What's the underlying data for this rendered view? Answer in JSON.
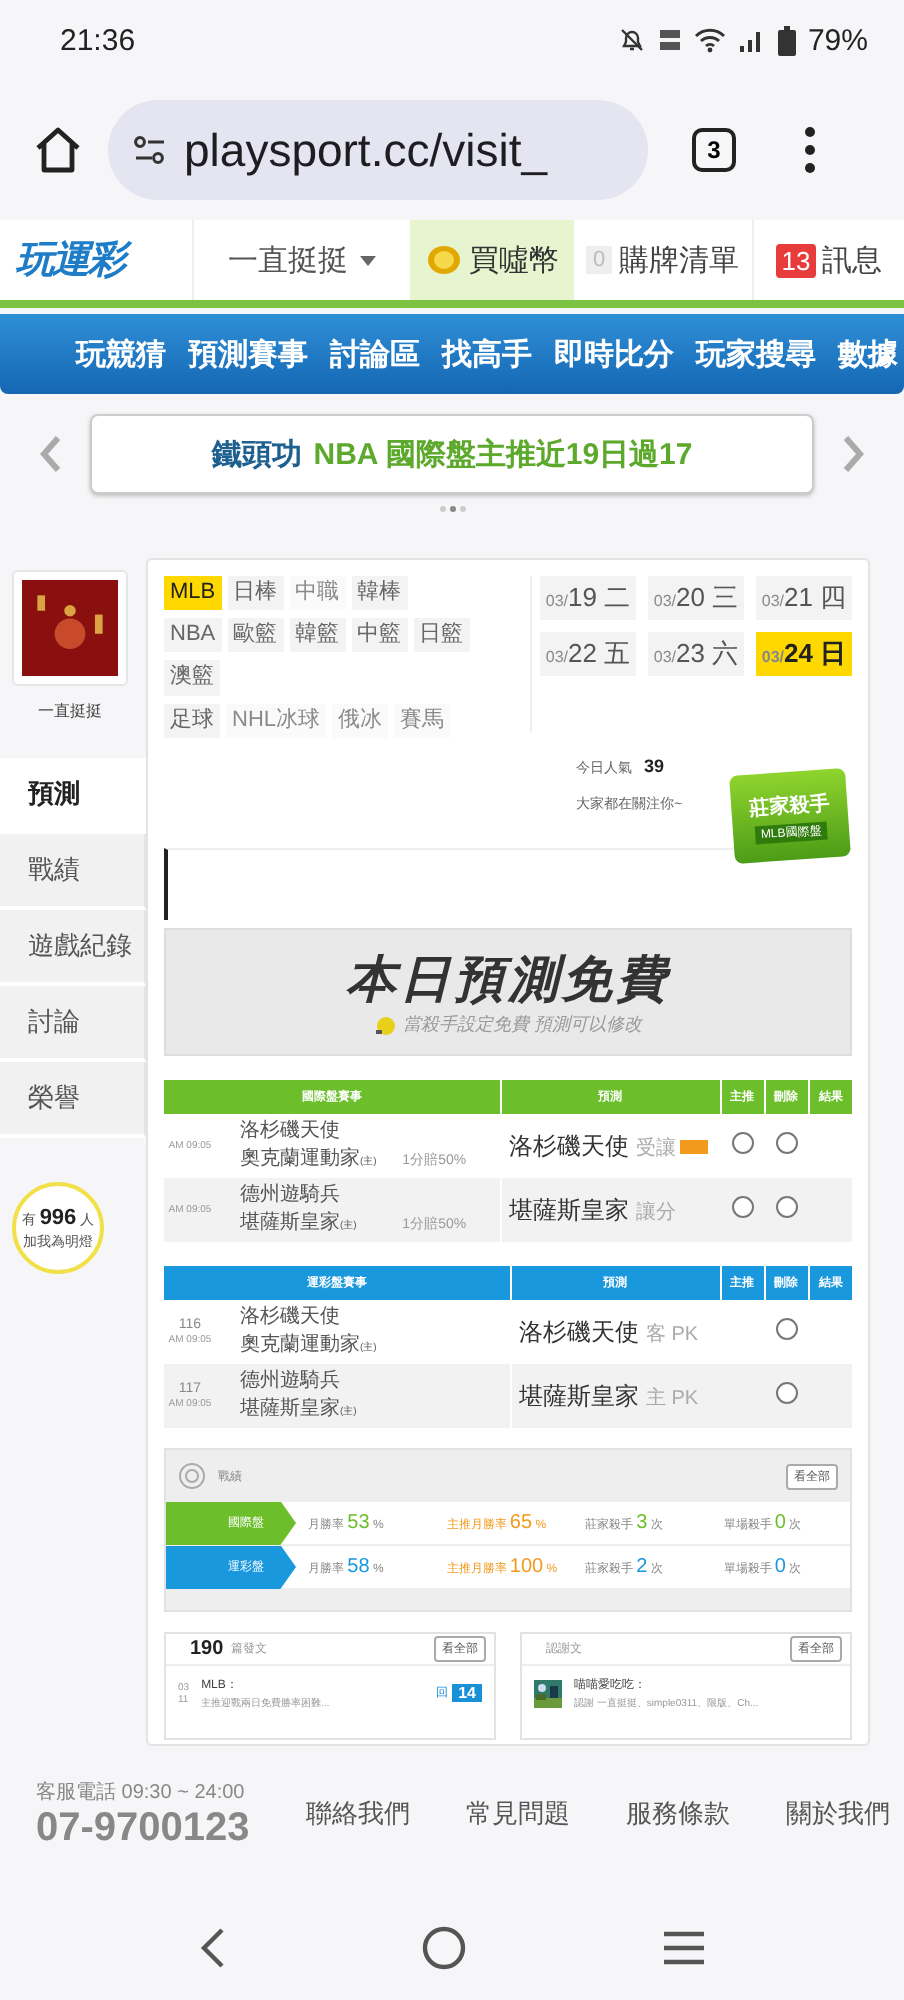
{
  "status_bar": {
    "time": "21:36",
    "battery": "79%"
  },
  "browser": {
    "url": "playsport.cc/visit_",
    "tab_count": "3"
  },
  "site_header": {
    "logo": "玩運彩",
    "user": "一直挺挺",
    "coins": "買噓幣",
    "cart_count": "0",
    "cart": "購牌清單",
    "message_count": "13",
    "messages": "訊息"
  },
  "nav": [
    "玩競猜",
    "預測賽事",
    "討論區",
    "找高手",
    "即時比分",
    "玩家搜尋",
    "數據"
  ],
  "banner": {
    "author": "鐵頭功",
    "text": "NBA 國際盤主推近19日過17"
  },
  "profile": {
    "name": "一直挺挺"
  },
  "side_menu": [
    {
      "label": "預測",
      "selected": true
    },
    {
      "label": "戰績",
      "selected": false
    },
    {
      "label": "遊戲紀錄",
      "selected": false
    },
    {
      "label": "討論",
      "selected": false
    },
    {
      "label": "榮譽",
      "selected": false
    }
  ],
  "fans": {
    "prefix": "有",
    "count": "996",
    "suffix": "人",
    "caption": "加我為明燈"
  },
  "leagues": [
    {
      "items": [
        {
          "label": "MLB",
          "selected": true,
          "disabled": false
        },
        {
          "label": "日棒",
          "selected": false,
          "disabled": false
        },
        {
          "label": "中職",
          "selected": false,
          "disabled": true
        },
        {
          "label": "韓棒",
          "selected": false,
          "disabled": false
        }
      ]
    },
    {
      "items": [
        {
          "label": "NBA",
          "selected": false,
          "disabled": false
        },
        {
          "label": "歐籃",
          "selected": false,
          "disabled": false
        },
        {
          "label": "韓籃",
          "selected": false,
          "disabled": false
        },
        {
          "label": "中籃",
          "selected": false,
          "disabled": false
        },
        {
          "label": "日籃",
          "selected": false,
          "disabled": false
        }
      ]
    },
    {
      "items": [
        {
          "label": "澳籃",
          "selected": false,
          "disabled": false
        }
      ]
    },
    {
      "items": [
        {
          "label": "足球",
          "selected": false,
          "disabled": false
        },
        {
          "label": "NHL冰球",
          "selected": false,
          "disabled": true
        },
        {
          "label": "俄冰",
          "selected": false,
          "disabled": true
        },
        {
          "label": "賽馬",
          "selected": false,
          "disabled": true
        }
      ]
    }
  ],
  "dates": [
    {
      "month": "03/",
      "day": "19",
      "weekday": "二",
      "selected": false
    },
    {
      "month": "03/",
      "day": "20",
      "weekday": "三",
      "selected": false
    },
    {
      "month": "03/",
      "day": "21",
      "weekday": "四",
      "selected": false
    },
    {
      "month": "03/",
      "day": "22",
      "weekday": "五",
      "selected": false
    },
    {
      "month": "03/",
      "day": "23",
      "weekday": "六",
      "selected": false
    },
    {
      "month": "03/",
      "day": "24",
      "weekday": "日",
      "selected": true
    }
  ],
  "popularity": {
    "label": "今日人氣",
    "count": "39",
    "note": "大家都在關注你~"
  },
  "badge": {
    "title": "莊家殺手",
    "subtitle": "MLB國際盤"
  },
  "promo": {
    "title": "本日預測免費",
    "subtitle": "當殺手設定免費 預測可以修改"
  },
  "tables": [
    {
      "kind": "intl",
      "columns": [
        "國際盤賽事",
        "預測",
        "主推",
        "刪除",
        "結果"
      ],
      "rows": [
        {
          "time": "AM 09:05",
          "away": "洛杉磯天使",
          "home": "奧克蘭運動家",
          "home_tag": "(主)",
          "odds": "1分賠50%",
          "pick": "洛杉磯天使",
          "pick_type": "受讓",
          "main_checked": false,
          "delete_checked": false
        },
        {
          "time": "AM 09:05",
          "away": "德州遊騎兵",
          "home": "堪薩斯皇家",
          "home_tag": "(主)",
          "odds": "1分賠50%",
          "pick": "堪薩斯皇家",
          "pick_type": "讓分",
          "main_checked": false,
          "delete_checked": false
        }
      ]
    },
    {
      "kind": "sports",
      "columns": [
        "運彩盤賽事",
        "預測",
        "主推",
        "刪除",
        "結果"
      ],
      "rows": [
        {
          "number": "116",
          "time": "AM 09:05",
          "away": "洛杉磯天使",
          "home": "奧克蘭運動家",
          "home_tag": "(主)",
          "pick": "洛杉磯天使",
          "pick_type": "客 PK",
          "delete_checked": false
        },
        {
          "number": "117",
          "time": "AM 09:05",
          "away": "德州遊騎兵",
          "home": "堪薩斯皇家",
          "home_tag": "(主)",
          "pick": "堪薩斯皇家",
          "pick_type": "主 PK",
          "delete_checked": false
        }
      ]
    }
  ],
  "record": {
    "title": "戰績",
    "more": "看全部",
    "rows": [
      {
        "kind": "intl",
        "label": "國際盤",
        "cells": [
          {
            "kind": "rate",
            "label": "月勝率",
            "value": "53",
            "unit": "%"
          },
          {
            "kind": "main",
            "label": "主推月勝率",
            "value": "65",
            "unit": "%"
          },
          {
            "kind": "count",
            "label": "莊家殺手",
            "value": "3",
            "unit": "次"
          },
          {
            "kind": "count",
            "label": "單場殺手",
            "value": "0",
            "unit": "次"
          }
        ]
      },
      {
        "kind": "sports",
        "label": "運彩盤",
        "cells": [
          {
            "kind": "rate",
            "label": "月勝率",
            "value": "58",
            "unit": "%"
          },
          {
            "kind": "main",
            "label": "主推月勝率",
            "value": "100",
            "unit": "%"
          },
          {
            "kind": "count",
            "label": "莊家殺手",
            "value": "2",
            "unit": "次"
          },
          {
            "kind": "count",
            "label": "單場殺手",
            "value": "0",
            "unit": "次"
          }
        ]
      }
    ]
  },
  "posts": {
    "count": "190",
    "label": "篇發文",
    "more": "看全部",
    "date": "03",
    "date_sub": "11",
    "league": "MLB：",
    "excerpt": "主推迎戰兩日免費勝率困難...",
    "reply_label": "回",
    "replies": "14"
  },
  "thanks": {
    "title": "認謝文",
    "more": "看全部",
    "user": "喵喵愛吃吃：",
    "excerpt": "認謝 一直挺挺、simple0311、限版、Ch..."
  },
  "footer": {
    "hours": "客服電話 09:30 ~ 24:00",
    "phone": "07-9700123",
    "links": [
      "聯絡我們",
      "常見問題",
      "服務條款",
      "關於我們"
    ]
  }
}
